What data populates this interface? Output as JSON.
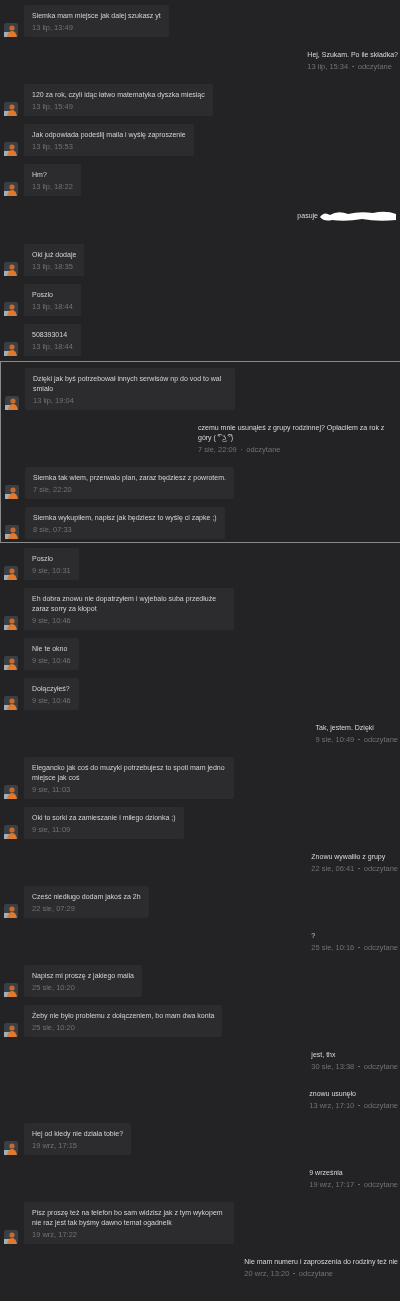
{
  "sections": [
    {
      "messages": [
        {
          "kind": "incoming",
          "text": "Siemka mam miejsce jak dalej szukasz yt",
          "time": "13 lip, 13:49"
        },
        {
          "kind": "outgoing",
          "text": "Hej, Szukam. Po ile składka?",
          "time": "13 lip, 15:34",
          "status": "odczytane"
        },
        {
          "kind": "incoming",
          "text": "120 za rok, czyli idąc łatwo matematyka dyszka miesiąc",
          "time": "13 lip, 15:49"
        },
        {
          "kind": "incoming",
          "text": "Jak odpowiada podeślij maila i wyślę zaproszenie",
          "time": "13 lip, 15:53"
        },
        {
          "kind": "incoming",
          "text": "Hm?",
          "time": "13 lip, 18:22"
        },
        {
          "kind": "outgoing",
          "text": "pasuje",
          "redacted": true
        },
        {
          "kind": "incoming",
          "text": "Oki już dodaje",
          "time": "13 lip, 18:35"
        },
        {
          "kind": "incoming",
          "text": "Poszlo",
          "time": "13 lip, 18:44"
        },
        {
          "kind": "incoming",
          "text": "508393014",
          "time": "13 lip, 18:44"
        }
      ]
    },
    {
      "highlighted": true,
      "messages": [
        {
          "kind": "incoming",
          "text": "Dzięki jak byś potrzebował innych serwisów np do vod to wal smialo",
          "time": "13 lip, 19:04"
        },
        {
          "kind": "outgoing",
          "text": "czemu mnie usunąłeś z grupy rodzinnej? Opłaciłem za rok z góry ( ͡° ͜ʖ ͡°)",
          "time": "7 sie, 22:09",
          "status": "odczytane"
        },
        {
          "kind": "incoming",
          "text": "Siemka tak wiem, przerwalo plan, zaraz będziesz z powrotem.",
          "time": "7 sie, 22:20"
        },
        {
          "kind": "incoming",
          "text": "Siemka wykupiłem, napisz jak będziesz to wyślę ci zapke ;)",
          "time": "8 sie, 07:33"
        }
      ]
    },
    {
      "messages": [
        {
          "kind": "incoming",
          "text": "Poszlo",
          "time": "9 sie, 10:31"
        },
        {
          "kind": "incoming",
          "text": "Eh dobra znowu nie dopatrzyłem i wyjebalo suba przedłuże zaraz sorry za kłopot",
          "time": "9 sie, 10:46"
        },
        {
          "kind": "incoming",
          "text": "Nie te okno",
          "time": "9 sie, 10:46"
        },
        {
          "kind": "incoming",
          "text": "Dołączyłeś?",
          "time": "9 sie, 10:46"
        },
        {
          "kind": "outgoing",
          "text": "Tak, jestem. Dzięki",
          "time": "9 sie, 10:49",
          "status": "odczytane"
        },
        {
          "kind": "incoming",
          "text": "Elegancko jak coś do muzyki potrzebujesz to spoti mam jedno miejsce jak coś",
          "time": "9 sie, 11:03"
        },
        {
          "kind": "incoming",
          "text": "Oki to sorki za zamieszanie i miłego dzionka ;)",
          "time": "9 sie, 11:09"
        },
        {
          "kind": "outgoing",
          "text": "Znowu wywaliło z grupy",
          "time": "22 sie, 06:41",
          "status": "odczytane"
        },
        {
          "kind": "incoming",
          "text": "Cześć niedługo dodam jakoś za 2h",
          "time": "22 sie, 07:29"
        },
        {
          "kind": "outgoing",
          "text": "?",
          "time": "25 sie, 10:16",
          "status": "odczytane"
        },
        {
          "kind": "incoming",
          "text": "Napisz mi proszę z jakiego maila",
          "time": "25 sie, 10:20"
        },
        {
          "kind": "incoming",
          "text": "Żeby nie było problemu z dołączeniem, bo mam dwa konta",
          "time": "25 sie, 10:20"
        },
        {
          "kind": "outgoing",
          "text": "jest, thx",
          "time": "30 sie, 13:38",
          "status": "odczytane"
        },
        {
          "kind": "outgoing",
          "text": "znowu usunęło",
          "time": "13 wrz, 17:10",
          "status": "odczytane"
        },
        {
          "kind": "incoming",
          "text": "Hej od kiedy nie działa tobie?",
          "time": "19 wrz, 17:15"
        },
        {
          "kind": "outgoing",
          "text": "9 września",
          "time": "19 wrz, 17:17",
          "status": "odczytane"
        },
        {
          "kind": "incoming",
          "text": "Pisz proszę też na telefon bo sam widzisz jak z tym wykopem nie raz jest tak byśmy dawno temat ogadnelk",
          "time": "19 wrz, 17:22"
        },
        {
          "kind": "outgoing",
          "text": "Nie mam numeru i zaproszenia do rodziny też nie",
          "time": "20 wrz, 13:20",
          "status": "odczytane"
        }
      ]
    }
  ]
}
